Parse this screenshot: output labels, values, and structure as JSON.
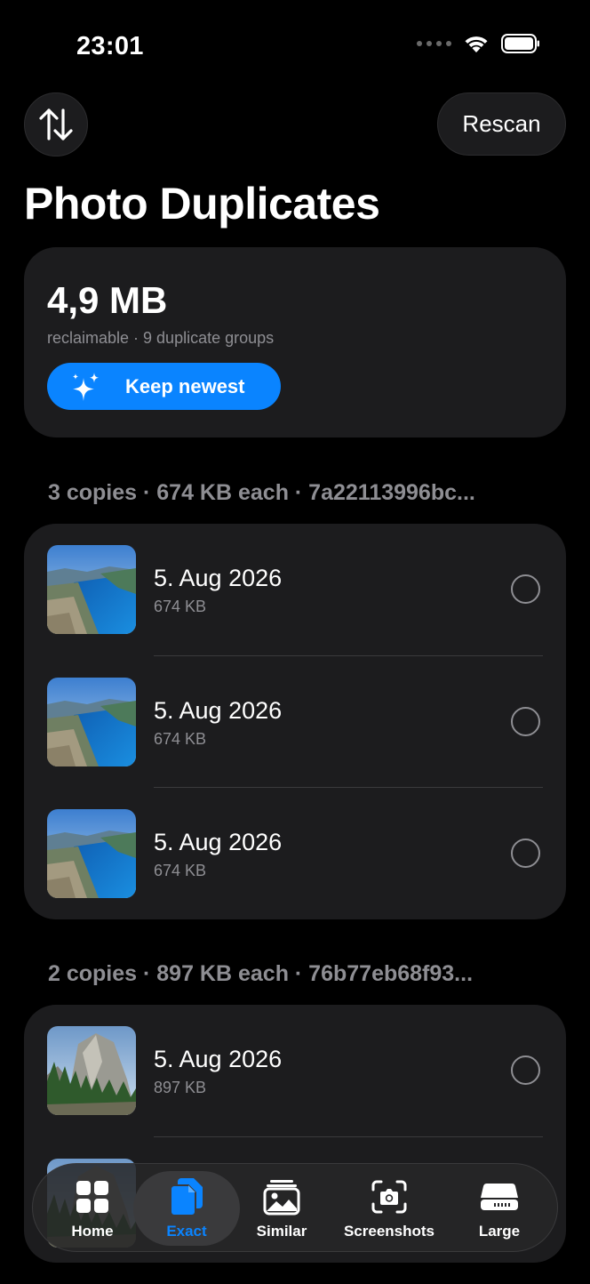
{
  "status_bar": {
    "time": "23:01"
  },
  "header": {
    "rescan_label": "Rescan",
    "title": "Photo Duplicates"
  },
  "summary": {
    "reclaimable": "4,9 MB",
    "subtitle": "reclaimable · 9 duplicate groups",
    "keep_label": "Keep newest"
  },
  "groups": [
    {
      "header": "3 copies · 674 KB each · 7a22113996bc...",
      "items": [
        {
          "date": "5. Aug 2026",
          "size": "674 KB",
          "selected": false,
          "image": "fjord"
        },
        {
          "date": "5. Aug 2026",
          "size": "674 KB",
          "selected": false,
          "image": "fjord"
        },
        {
          "date": "5. Aug 2026",
          "size": "674 KB",
          "selected": false,
          "image": "fjord"
        }
      ]
    },
    {
      "header": "2 copies · 897 KB each · 76b77eb68f93...",
      "items": [
        {
          "date": "5. Aug 2026",
          "size": "897 KB",
          "selected": false,
          "image": "yosemite"
        }
      ]
    }
  ],
  "tabs": [
    {
      "label": "Home",
      "icon": "grid-icon",
      "active": false
    },
    {
      "label": "Exact",
      "icon": "duplicate-docs-icon",
      "active": true
    },
    {
      "label": "Similar",
      "icon": "photo-stack-icon",
      "active": false
    },
    {
      "label": "Screenshots",
      "icon": "camera-viewfinder-icon",
      "active": false
    },
    {
      "label": "Large",
      "icon": "storage-drive-icon",
      "active": false
    }
  ],
  "colors": {
    "accent": "#0a84ff",
    "card": "#1c1c1e",
    "secondary_text": "#8e8e93",
    "background": "#000000"
  }
}
